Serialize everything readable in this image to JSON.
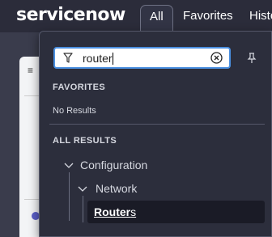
{
  "header": {
    "logo_text": "servicenow",
    "tabs": [
      {
        "label": "All"
      },
      {
        "label": "Favorites"
      },
      {
        "label": "Histo"
      }
    ]
  },
  "background": {
    "menu_glyph": "≡"
  },
  "search": {
    "value": "router"
  },
  "favorites": {
    "title": "FAVORITES",
    "empty_text": "No Results"
  },
  "all_results": {
    "title": "ALL RESULTS",
    "tree": {
      "level1": "Configuration",
      "level2": "Network",
      "match": {
        "bold": "Router",
        "rest": "s"
      }
    }
  },
  "colors": {
    "accent": "#4a8fe0",
    "panel_bg": "#2c2e3c",
    "selected_row_bg": "#1a1b26",
    "brand_green": "#7fd34a"
  },
  "icons": {
    "filter": "filter-icon",
    "clear": "clear-circle-icon",
    "pin": "pin-icon",
    "chevron": "chevron-down-icon"
  }
}
